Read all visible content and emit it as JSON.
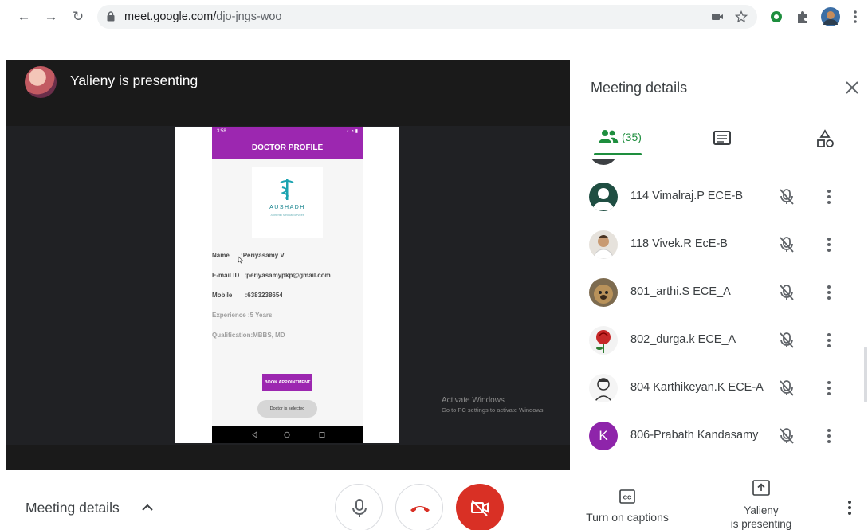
{
  "browser": {
    "url_host": "meet.google.com/",
    "url_path": "djo-jngs-woo"
  },
  "stage": {
    "presenter_text": "Yalieny is presenting",
    "shared_screen": {
      "status_time": "3:58",
      "title": "DOCTOR PROFILE",
      "logo_text": "AUSHADH",
      "logo_subtext": "Authentic Medical Services",
      "fields": {
        "name_label": "Name",
        "name_value": ":Periyasamy V",
        "email_label": "E-mail ID",
        "email_value": ":periyasamypkp@gmail.com",
        "mobile_label": "Mobile",
        "mobile_value": ":6383238654",
        "experience": "Experience :5 Years",
        "qualification": "Qualification:MBBS, MD"
      },
      "book_button": "BOOK APPOINTMENT",
      "toast": "Doctor is selected"
    },
    "watermark": {
      "title": "Activate Windows",
      "subtitle": "Go to PC settings to activate Windows."
    }
  },
  "panel": {
    "title": "Meeting details",
    "people_count": "(35)",
    "participants": [
      {
        "name": "114 Vimalraj.P ECE-B"
      },
      {
        "name": "118 Vivek.R EcE-B"
      },
      {
        "name": "801_arthi.S ECE_A"
      },
      {
        "name": "802_durga.k ECE_A"
      },
      {
        "name": "804 Karthikeyan.K ECE-A"
      },
      {
        "name": "806-Prabath Kandasamy",
        "initial": "K"
      }
    ]
  },
  "bottom": {
    "meeting_details": "Meeting details",
    "captions": "Turn on captions",
    "presenting_line1": "Yalieny",
    "presenting_line2": "is presenting"
  },
  "colors": {
    "accent_green": "#1e8e3e",
    "hangup_red": "#d93025",
    "phone_purple": "#9c27b0"
  }
}
